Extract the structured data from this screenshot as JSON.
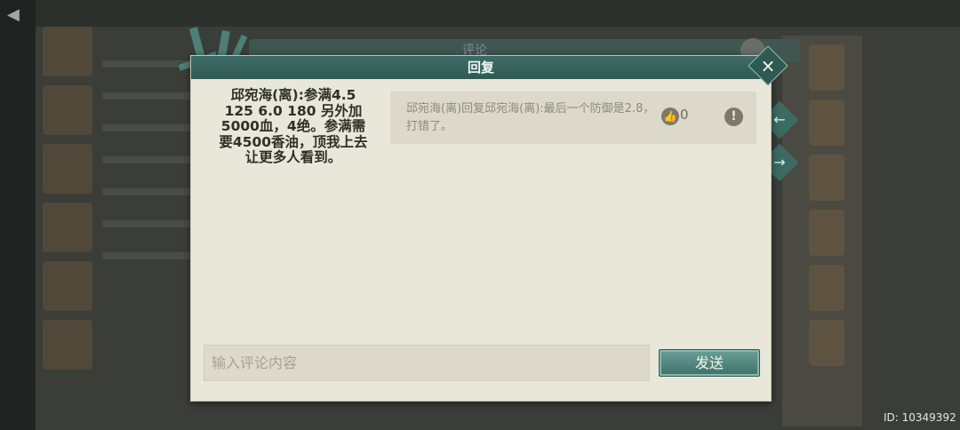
{
  "background": {
    "behind_title": "评论"
  },
  "dialog": {
    "title": "回复",
    "close_label": "×"
  },
  "original_comment": {
    "text": "邱宛海(离):参满4.5 125  6.0 180 另外加5000血，4绝。参满需要4500香油，顶我上去让更多人看到。"
  },
  "reply": {
    "text": "邱宛海(离)回复邱宛海(离):最后一个防御是2.8，打错了。",
    "like_count": "0"
  },
  "input": {
    "placeholder": "输入评论内容",
    "value": ""
  },
  "send_button": {
    "label": "发送"
  },
  "footer": {
    "id_text": "ID: 10349392"
  },
  "icons": {
    "like": "thumbs-up-icon",
    "report": "exclamation-icon",
    "close": "close-icon",
    "back": "back-arrow-icon",
    "prev": "left-arrow-icon",
    "next": "right-arrow-icon"
  },
  "colors": {
    "header": "#3f6d66",
    "dialog_bg": "#e9e6da",
    "send_button": "#4f8278"
  }
}
